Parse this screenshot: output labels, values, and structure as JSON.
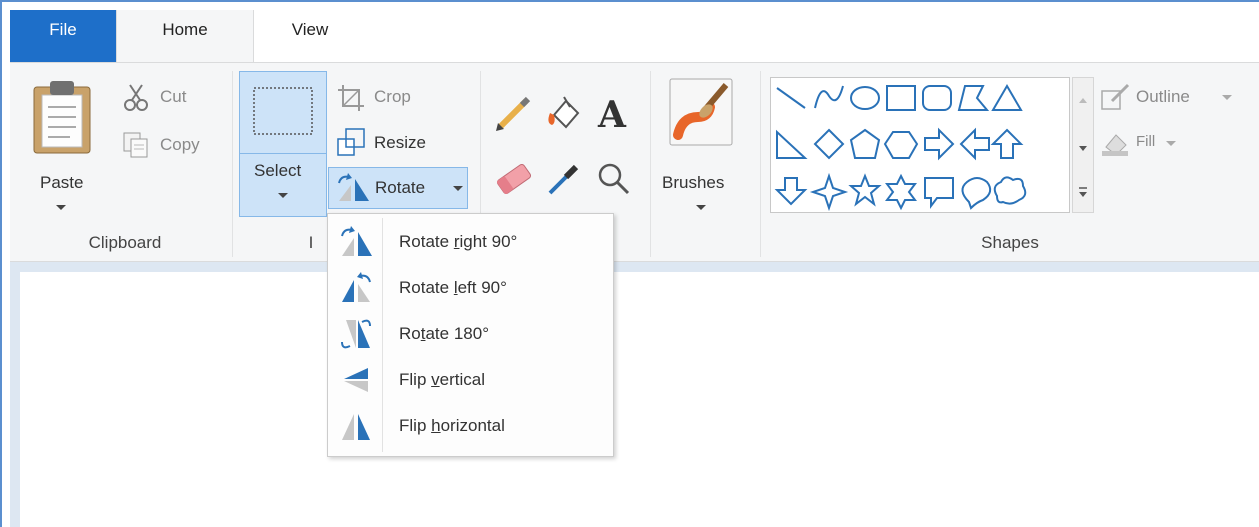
{
  "tabs": {
    "file": "File",
    "home": "Home",
    "view": "View"
  },
  "clipboard": {
    "paste": "Paste",
    "cut": "Cut",
    "copy": "Copy",
    "group": "Clipboard"
  },
  "image": {
    "select": "Select",
    "crop": "Crop",
    "resize": "Resize",
    "rotate": "Rotate",
    "group": "I"
  },
  "brushes": {
    "label": "Brushes"
  },
  "shapes": {
    "group": "Shapes",
    "outline": "Outline",
    "fill": "Fill"
  },
  "rotate_menu": {
    "items": [
      {
        "pre": "Rotate ",
        "u": "r",
        "post": "ight 90°"
      },
      {
        "pre": "Rotate ",
        "u": "l",
        "post": "eft 90°"
      },
      {
        "pre": "Ro",
        "u": "t",
        "post": "ate 180°"
      },
      {
        "pre": "Flip ",
        "u": "v",
        "post": "ertical"
      },
      {
        "pre": "Flip ",
        "u": "h",
        "post": "orizontal"
      }
    ]
  },
  "colors": {
    "accent": "#1e6fc9",
    "icon_blue": "#2a72b8",
    "select_bg": "#cde3f8"
  }
}
